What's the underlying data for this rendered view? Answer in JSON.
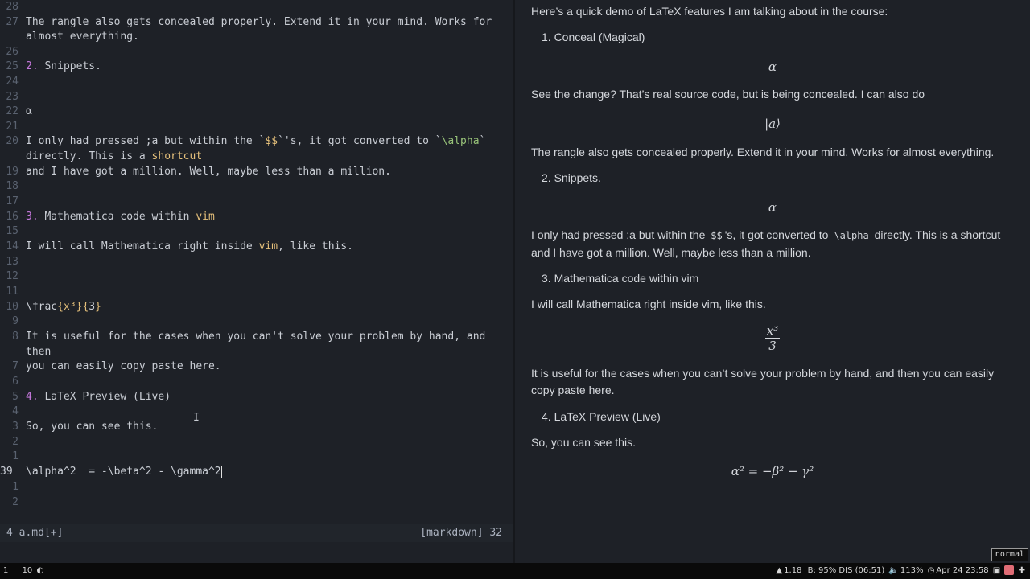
{
  "editor": {
    "lines": [
      {
        "num": "28",
        "segs": []
      },
      {
        "num": "27",
        "segs": [
          {
            "t": "The rangle also gets concealed properly. Extend it in your mind. Works for"
          }
        ]
      },
      {
        "num": "",
        "segs": [
          {
            "t": "almost everything."
          }
        ]
      },
      {
        "num": "26",
        "segs": []
      },
      {
        "num": "25",
        "segs": [
          {
            "t": "2. ",
            "c": "num"
          },
          {
            "t": "Snippets."
          }
        ]
      },
      {
        "num": "24",
        "segs": []
      },
      {
        "num": "23",
        "segs": []
      },
      {
        "num": "22",
        "segs": [
          {
            "t": "α"
          }
        ]
      },
      {
        "num": "21",
        "segs": []
      },
      {
        "num": "20",
        "segs": [
          {
            "t": "I only had pressed ;a but within the `"
          },
          {
            "t": "$$",
            "c": "tick"
          },
          {
            "t": "`'s, it got converted to `"
          },
          {
            "t": "\\alpha",
            "c": "grn"
          },
          {
            "t": "`"
          }
        ]
      },
      {
        "num": "",
        "segs": [
          {
            "t": "directly. This is a "
          },
          {
            "t": "shortcut",
            "c": "hl"
          }
        ]
      },
      {
        "num": "19",
        "segs": [
          {
            "t": "and I have got a million. Well, maybe less than a million."
          }
        ]
      },
      {
        "num": "18",
        "segs": []
      },
      {
        "num": "17",
        "segs": []
      },
      {
        "num": "16",
        "segs": [
          {
            "t": "3. ",
            "c": "num"
          },
          {
            "t": "Mathematica code within "
          },
          {
            "t": "vim",
            "c": "hl"
          }
        ]
      },
      {
        "num": "15",
        "segs": []
      },
      {
        "num": "14",
        "segs": [
          {
            "t": "I will call Mathematica right inside "
          },
          {
            "t": "vim",
            "c": "hl"
          },
          {
            "t": ", like this."
          }
        ]
      },
      {
        "num": "13",
        "segs": []
      },
      {
        "num": "12",
        "segs": []
      },
      {
        "num": "11",
        "segs": []
      },
      {
        "num": "10",
        "segs": [
          {
            "t": "\\frac"
          },
          {
            "t": "{x³}{",
            "c": "hl"
          },
          {
            "t": "3"
          },
          {
            "t": "}",
            "c": "hl"
          }
        ]
      },
      {
        "num": "9",
        "segs": []
      },
      {
        "num": "8",
        "segs": [
          {
            "t": "It is useful for the cases when you can't solve your problem by hand, and"
          }
        ]
      },
      {
        "num": "",
        "segs": [
          {
            "t": "then"
          }
        ]
      },
      {
        "num": "7",
        "segs": [
          {
            "t": "you can easily copy paste here."
          }
        ]
      },
      {
        "num": "6",
        "segs": []
      },
      {
        "num": "5",
        "segs": [
          {
            "t": "4. ",
            "c": "num"
          },
          {
            "t": "LaTeX Preview (Live)"
          }
        ]
      },
      {
        "num": "4",
        "segs": []
      },
      {
        "num": "3",
        "segs": [
          {
            "t": "So, you can see this."
          }
        ]
      },
      {
        "num": "2",
        "segs": []
      },
      {
        "num": "1",
        "segs": []
      },
      {
        "num": "39",
        "cur": true,
        "cursor": true,
        "segs": [
          {
            "t": "\\alpha^2  = -\\beta^2 - \\gamma^2"
          }
        ]
      },
      {
        "num": "1",
        "segs": []
      },
      {
        "num": "2",
        "segs": []
      }
    ],
    "status_left": "4 a.md[+]",
    "status_right": "[markdown]  32"
  },
  "preview": {
    "intro": "Here’s a quick demo of LaTeX features I am talking about in the course:",
    "item1": "1. Conceal (Magical)",
    "math1": "α",
    "p_change": "See the change? That’s real source code, but is being concealed. I can also do",
    "math2": "|a⟩",
    "p_rangle": "The rangle also gets concealed properly. Extend it in your mind. Works for almost everything.",
    "item2": "2. Snippets.",
    "math3": "α",
    "p_pressed_a": "I only had pressed ;a but within the",
    "code_dollar": "$$",
    "p_pressed_b": "'s, it got converted to",
    "code_alpha": "\\alpha",
    "p_pressed_c": "directly. This is a shortcut and I have got a million. Well, maybe less than a million.",
    "item3": "3. Mathematica code within vim",
    "p_mathematica": "I will call Mathematica right inside vim, like this.",
    "frac_num": "x³",
    "frac_den": "3",
    "p_useful": "It is useful for the cases when you can’t solve your problem by hand, and then you can easily copy paste here.",
    "item4": "4. LaTeX Preview (Live)",
    "p_see": "So, you can see this.",
    "math_final": "α² = −β² − γ²"
  },
  "mode_badge": "normal",
  "taskbar": {
    "workspace": "1",
    "count": "10",
    "battery": "1.18",
    "status": "B: 95% DIS (06:51)",
    "volume": "113%",
    "datetime": "Apr 24 23:58"
  }
}
